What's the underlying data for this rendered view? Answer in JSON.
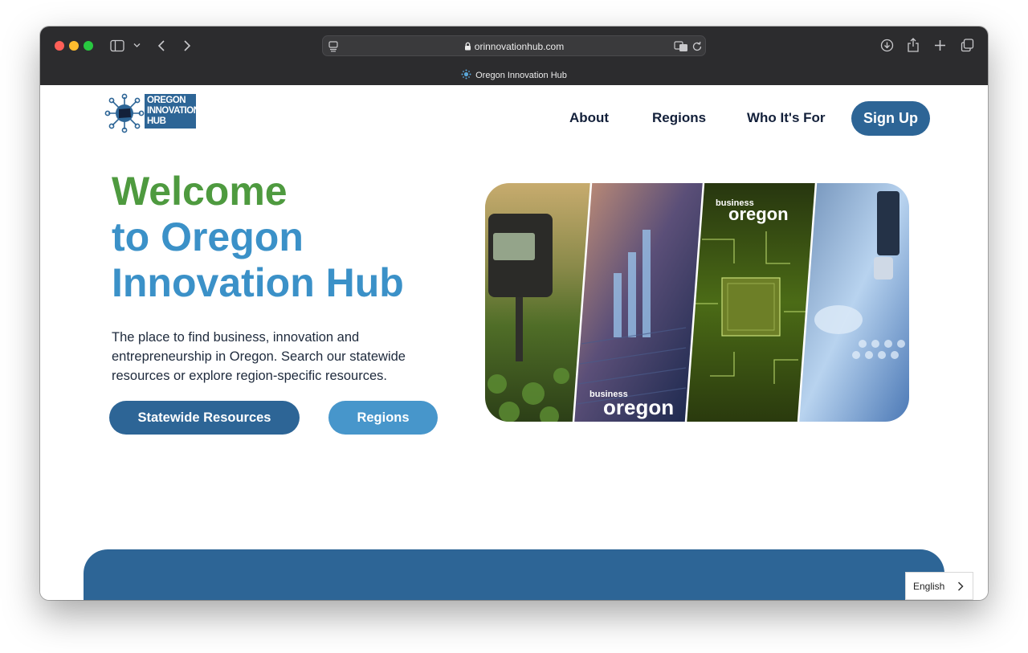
{
  "browser": {
    "url": "orinnovationhub.com",
    "tab_title": "Oregon Innovation Hub",
    "icons": [
      "sidebar-icon",
      "chevron-down-icon",
      "back-icon",
      "forward-icon",
      "reader-icon",
      "lock-icon",
      "translate-icon",
      "reload-icon",
      "download-icon",
      "share-icon",
      "new-tab-icon",
      "tab-overview-icon"
    ]
  },
  "header": {
    "logo_lines": [
      "OREGON",
      "INNOVATION",
      "HUB"
    ],
    "nav": [
      "About",
      "Regions",
      "Who It's For"
    ],
    "signup_label": "Sign Up"
  },
  "hero": {
    "title_line1": "Welcome",
    "title_line2": "to Oregon",
    "title_line3": "Innovation Hub",
    "description": "The place to find business, innovation and entrepreneurship in Oregon. Search our statewide resources or explore region-specific resources.",
    "primary_button": "Statewide Resources",
    "secondary_button": "Regions"
  },
  "collage": {
    "brand_small": "business",
    "brand_large": "oregon"
  },
  "language": {
    "selected": "English"
  },
  "colors": {
    "brand_blue": "#2d6596",
    "light_blue": "#4796cb",
    "green": "#4e9a3f",
    "titlebar": "#2c2c2e"
  }
}
